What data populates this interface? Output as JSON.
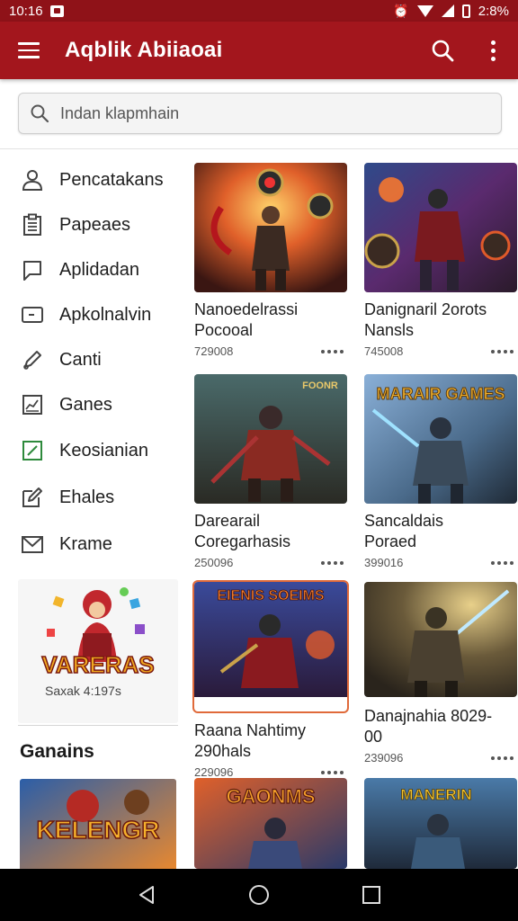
{
  "status": {
    "time": "10:16",
    "battery": "2:8%"
  },
  "app": {
    "title": "Aqblik Abiiaoai"
  },
  "search": {
    "placeholder": "Indan klapmhain"
  },
  "sidebar": {
    "items": [
      {
        "label": "Pencatakans",
        "icon": "person-icon"
      },
      {
        "label": "Papeaes",
        "icon": "clipboard-icon"
      },
      {
        "label": "Aplidadan",
        "icon": "bookmark-icon"
      },
      {
        "label": "Apkolnalvin",
        "icon": "window-icon"
      },
      {
        "label": "Canti",
        "icon": "pencil-icon"
      },
      {
        "label": "Ganes",
        "icon": "chart-icon"
      },
      {
        "label": "Keosianian",
        "icon": "checkbox-icon"
      },
      {
        "label": "Ehales",
        "icon": "edit-icon"
      },
      {
        "label": "Krame",
        "icon": "mail-icon"
      }
    ],
    "promo": {
      "label": "Saxak 4:197s"
    },
    "section_title": "Ganains"
  },
  "games": [
    {
      "title": "Nanoedelrassi Pocooal",
      "size": "729008"
    },
    {
      "title": "Danignaril 2orots Nansls",
      "size": "745008"
    },
    {
      "title": "Darearail Coregarhasis",
      "size": "250096"
    },
    {
      "title": "Sancaldais Poraed",
      "size": "399016"
    },
    {
      "title": "Raana Nahtimy 290hals",
      "size": "229096"
    },
    {
      "title": "Danajnahia 8029-00",
      "size": "239096"
    },
    {
      "title": "",
      "size": ""
    },
    {
      "title": "",
      "size": ""
    }
  ],
  "art_text": {
    "card3_banner": "FOONR",
    "card4_banner": "MARAIR GAMES",
    "card5_banner": "EIENIS SOEIMS",
    "card7_banner": "GAONMS",
    "card8_banner": "MANERIN",
    "side_banner": "KELENGR",
    "promo_banner": "VARERAS"
  },
  "colors": {
    "app_bar": "#a3161d",
    "status_bar": "#8f1218"
  }
}
